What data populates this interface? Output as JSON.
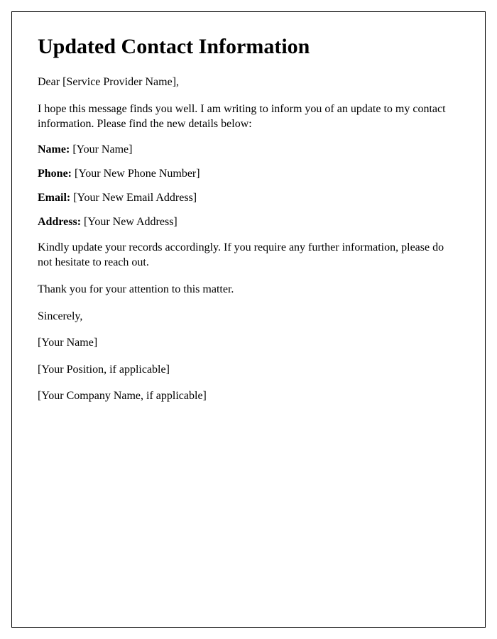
{
  "title": "Updated Contact Information",
  "salutation": "Dear [Service Provider Name],",
  "intro": "I hope this message finds you well. I am writing to inform you of an update to my contact information. Please find the new details below:",
  "fields": {
    "name_label": "Name:",
    "name_value": " [Your Name]",
    "phone_label": "Phone:",
    "phone_value": " [Your New Phone Number]",
    "email_label": "Email:",
    "email_value": " [Your New Email Address]",
    "address_label": "Address:",
    "address_value": " [Your New Address]"
  },
  "closing_request": "Kindly update your records accordingly. If you require any further information, please do not hesitate to reach out.",
  "thanks": "Thank you for your attention to this matter.",
  "signoff": "Sincerely,",
  "signature_name": "[Your Name]",
  "signature_position": "[Your Position, if applicable]",
  "signature_company": "[Your Company Name, if applicable]"
}
